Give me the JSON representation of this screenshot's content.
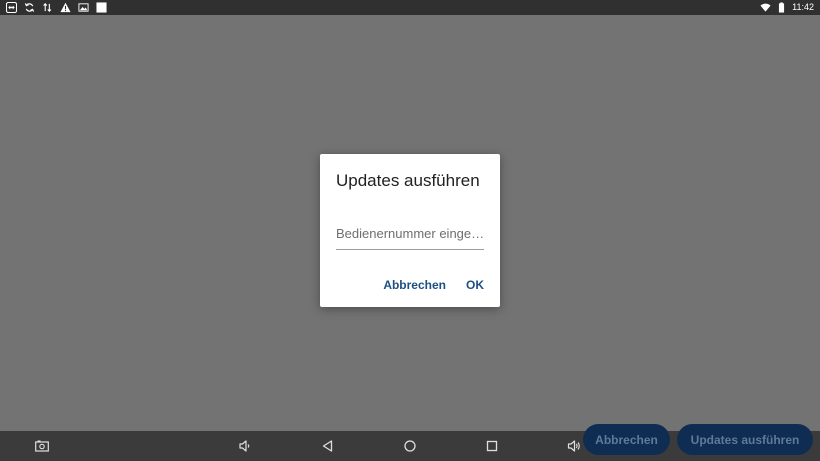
{
  "status_bar": {
    "time": "11:42",
    "icons": [
      "teamviewer-icon",
      "sync-icon",
      "data-transfer-icon",
      "warning-icon",
      "image-icon",
      "blank-square-icon",
      "wifi-icon",
      "battery-icon"
    ]
  },
  "dialog": {
    "title": "Updates ausführen",
    "input_placeholder": "Bedienernummer einge…",
    "input_value": "",
    "cancel_label": "Abbrechen",
    "ok_label": "OK"
  },
  "background_buttons": {
    "cancel_label": "Abbrechen",
    "update_label": "Updates ausführen"
  },
  "nav_bar": {
    "icons": [
      "screenshot-icon",
      "volume-down-icon",
      "back-icon",
      "home-icon",
      "recents-icon",
      "volume-up-icon"
    ]
  },
  "colors": {
    "scrim": "#737373",
    "accent": "#1e4f82",
    "status_bar": "#303030",
    "nav_bar": "#3b3b3b",
    "pill": "#0f2d52"
  }
}
